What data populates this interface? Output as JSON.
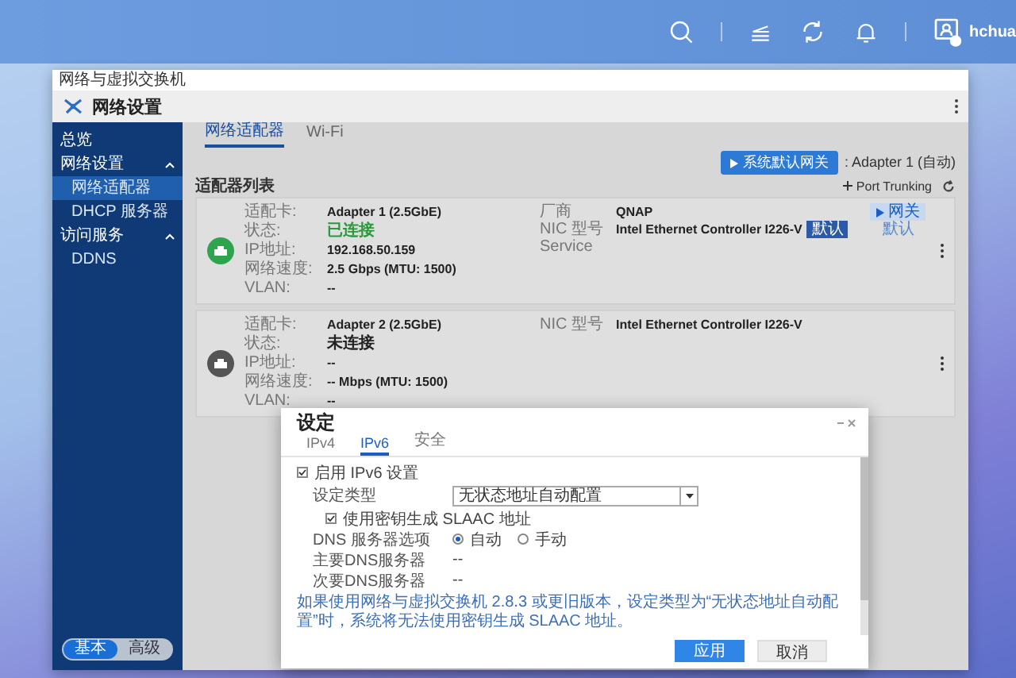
{
  "top_bar": {
    "user": "hchua"
  },
  "window": {
    "title": "网络与虚拟交换机",
    "app_title": "网络设置"
  },
  "sidebar": {
    "items": [
      {
        "label": "总览",
        "selected": false
      },
      {
        "label": "网络设置",
        "selected": false,
        "expanded": true,
        "children": [
          {
            "label": "网络适配器",
            "selected": true
          },
          {
            "label": "DHCP 服务器",
            "selected": false
          }
        ]
      },
      {
        "label": "访问服务",
        "selected": false,
        "expanded": true,
        "children": [
          {
            "label": "DDNS",
            "selected": false
          }
        ]
      }
    ],
    "mode_toggle": [
      {
        "label": "基本",
        "selected": true
      },
      {
        "label": "高级",
        "selected": false
      }
    ]
  },
  "tabs": [
    {
      "label": "网络适配器",
      "selected": true
    },
    {
      "label": "Wi-Fi",
      "selected": false
    }
  ],
  "gateway": {
    "button": "系统默认网关",
    "value": ": Adapter 1 (自动)"
  },
  "list_title": "适配器列表",
  "port_trunking": "Port Trunking",
  "adapters": [
    {
      "connected": true,
      "fields": [
        {
          "label": "适配卡:",
          "value": "Adapter 1 (2.5GbE)"
        },
        {
          "label": "状态:",
          "value": "已连接"
        },
        {
          "label": "IP地址:",
          "value": "192.168.50.159"
        },
        {
          "label": "网络速度:",
          "value": "2.5 Gbps (MTU: 1500)"
        },
        {
          "label": "VLAN:",
          "value": "--"
        }
      ],
      "details": [
        {
          "label": "厂商",
          "value": "QNAP"
        },
        {
          "label": "NIC 型号",
          "value": "Intel Ethernet Controller I226-V",
          "badge": "默认"
        },
        {
          "label": "Service"
        }
      ],
      "tag": {
        "label": "网关",
        "note": "默认"
      }
    },
    {
      "connected": false,
      "fields": [
        {
          "label": "适配卡:",
          "value": "Adapter 2 (2.5GbE)"
        },
        {
          "label": "状态:",
          "value": "未连接"
        },
        {
          "label": "IP地址:",
          "value": "--"
        },
        {
          "label": "网络速度:",
          "value": "-- Mbps (MTU: 1500)"
        },
        {
          "label": "VLAN:",
          "value": "--"
        }
      ],
      "details": [
        {
          "label": "NIC 型号",
          "value": "Intel Ethernet Controller I226-V"
        }
      ]
    }
  ],
  "dialog": {
    "title": "设定",
    "tabs": [
      {
        "label": "IPv4",
        "selected": false
      },
      {
        "label": "IPv6",
        "selected": true
      },
      {
        "label": "安全",
        "selected": false
      }
    ],
    "enable": {
      "label": "启用 IPv6 设置",
      "checked": true
    },
    "type": {
      "label": "设定类型",
      "value": "无状态地址自动配置"
    },
    "slaac": {
      "label": "使用密钥生成 SLAAC 地址",
      "checked": true
    },
    "dns": {
      "label": "DNS 服务器选项",
      "options": [
        {
          "label": "自动",
          "selected": true
        },
        {
          "label": "手动",
          "selected": false
        }
      ]
    },
    "primary": {
      "label": "主要DNS服务器",
      "value": "--"
    },
    "secondary": {
      "label": "次要DNS服务器",
      "value": "--"
    },
    "note": "如果使用网络与虚拟交换机 2.8.3 或更旧版本，设定类型为“无状态地址自动配置”时，系统将无法使用密钥生成 SLAAC 地址。",
    "buttons": [
      {
        "label": "应用",
        "kind": "primary"
      },
      {
        "label": "取消",
        "kind": "secondary"
      }
    ]
  }
}
